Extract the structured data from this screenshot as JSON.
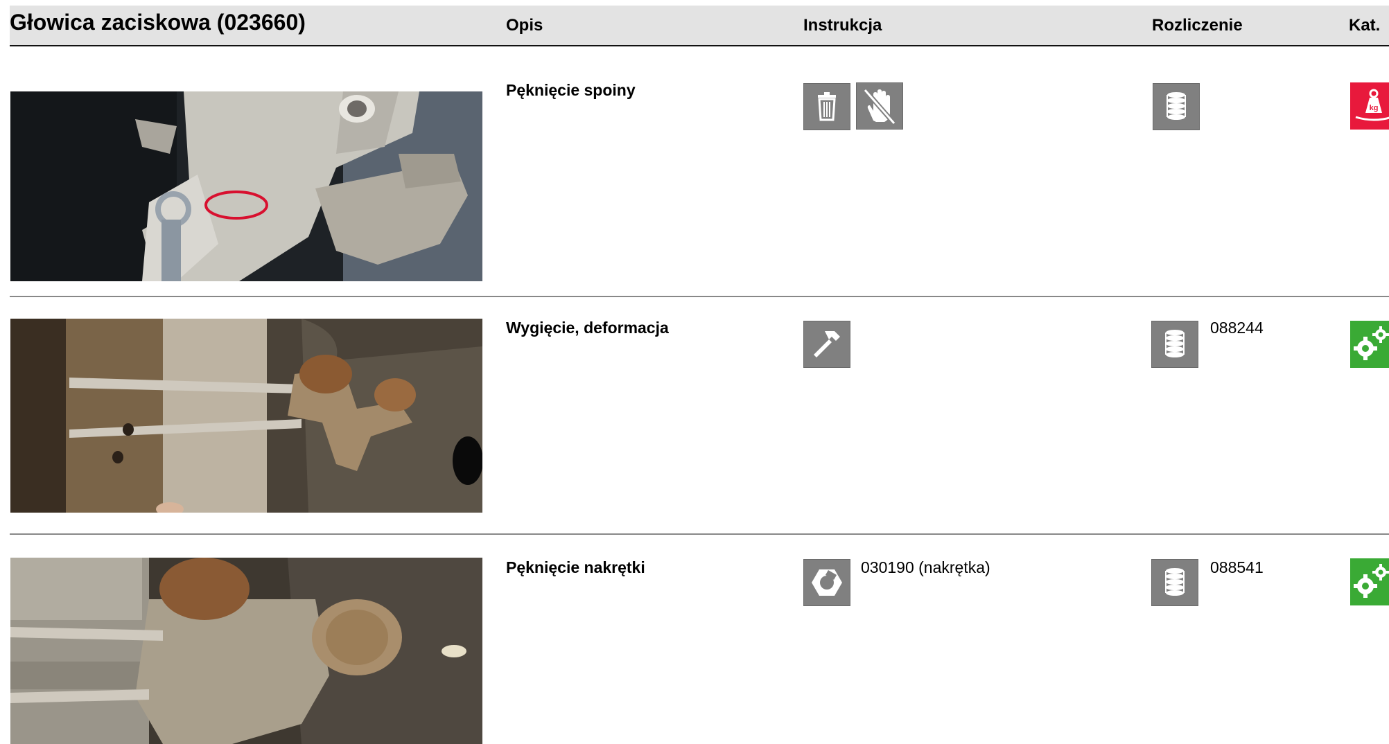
{
  "header": {
    "title": "Głowica zaciskowa (023660)",
    "col_opis": "Opis",
    "col_instrukcja": "Instrukcja",
    "col_rozliczenie": "Rozliczenie",
    "col_kat": "Kat."
  },
  "rows": [
    {
      "opis": "Pęknięcie spoiny",
      "instrukcja_icons": [
        "trash-icon",
        "no-hand-icon"
      ],
      "instrukcja_text": "",
      "rozliczenie_icon": "coin-stack-icon",
      "rozliczenie_text": "",
      "kat_icon": "weight-kg-icon",
      "kat_color": "#e8193c"
    },
    {
      "opis": "Wygięcie, deformacja",
      "instrukcja_icons": [
        "hammer-icon"
      ],
      "instrukcja_text": "",
      "rozliczenie_icon": "coin-stack-icon",
      "rozliczenie_text": "088244",
      "kat_icon": "gears-icon",
      "kat_color": "#3aaa35"
    },
    {
      "opis": "Pęknięcie nakrętki",
      "instrukcja_icons": [
        "hex-nut-icon"
      ],
      "instrukcja_text": "030190 (nakrętka)",
      "rozliczenie_icon": "coin-stack-icon",
      "rozliczenie_text": "088541",
      "kat_icon": "gears-icon",
      "kat_color": "#3aaa35"
    }
  ],
  "colors": {
    "header_bg": "#e3e3e3",
    "icon_box": "#808080",
    "red_marker": "#d8102f"
  }
}
